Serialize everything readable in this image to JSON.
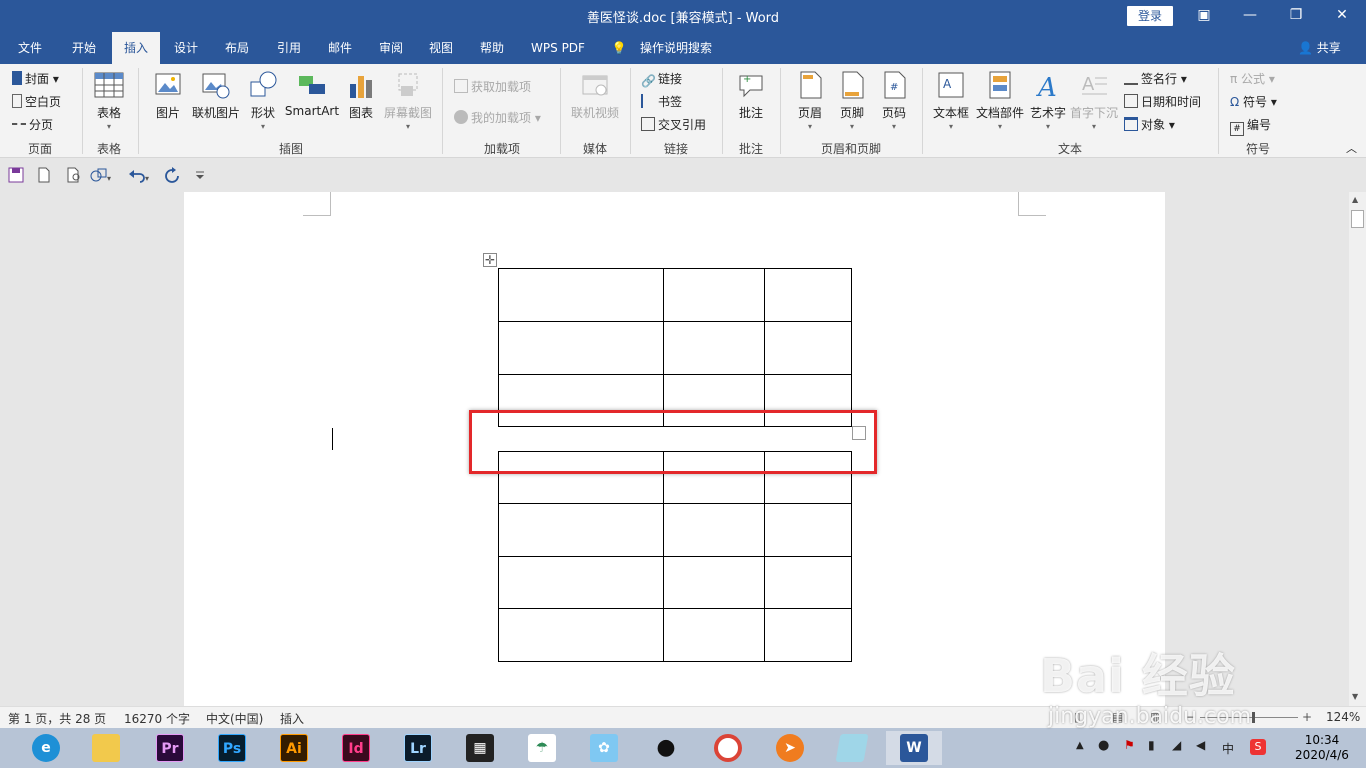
{
  "window": {
    "title": "善医怪谈.doc [兼容模式]  -  Word",
    "login_label": "登录"
  },
  "tabs": [
    {
      "label": "文件"
    },
    {
      "label": "开始"
    },
    {
      "label": "插入"
    },
    {
      "label": "设计"
    },
    {
      "label": "布局"
    },
    {
      "label": "引用"
    },
    {
      "label": "邮件"
    },
    {
      "label": "审阅"
    },
    {
      "label": "视图"
    },
    {
      "label": "帮助"
    },
    {
      "label": "WPS PDF"
    },
    {
      "label": "操作说明搜索"
    }
  ],
  "active_tab": "插入",
  "share_label": "共享",
  "ribbon": {
    "pages": {
      "group": "页面",
      "cover": "封面",
      "blank": "空白页",
      "break": "分页"
    },
    "tables": {
      "group": "表格",
      "table": "表格"
    },
    "illustrations": {
      "group": "插图",
      "picture": "图片",
      "online_picture": "联机图片",
      "shapes": "形状",
      "smartart": "SmartArt",
      "chart": "图表",
      "screenshot": "屏幕截图"
    },
    "addins": {
      "group": "加载项",
      "get": "获取加载项",
      "my": "我的加载项"
    },
    "media": {
      "group": "媒体",
      "online_video": "联机视频"
    },
    "links": {
      "group": "链接",
      "link": "链接",
      "bookmark": "书签",
      "cross_ref": "交叉引用"
    },
    "comments": {
      "group": "批注",
      "comment": "批注"
    },
    "header_footer": {
      "group": "页眉和页脚",
      "header": "页眉",
      "footer": "页脚",
      "page_number": "页码"
    },
    "text": {
      "group": "文本",
      "textbox": "文本框",
      "quick_parts": "文档部件",
      "wordart": "艺术字",
      "dropcap": "首字下沉",
      "signature": "签名行",
      "datetime": "日期和时间",
      "object": "对象"
    },
    "symbols": {
      "group": "符号",
      "equation": "公式",
      "symbol": "符号",
      "number": "编号"
    }
  },
  "status": {
    "page": "第 1 页，共 28 页",
    "words": "16270 个字",
    "language": "中文(中国)",
    "mode": "插入",
    "zoom": "124%"
  },
  "taskbar": {
    "apps": [
      "Pr",
      "Ps",
      "Ai",
      "Id",
      "Lr"
    ],
    "time": "10:34",
    "date": "2020/4/6",
    "ime": "中"
  },
  "watermark": {
    "brand": "Bai 经验",
    "url": "jingyan.baidu.com"
  },
  "colors": {
    "accent": "#2b579a",
    "highlight": "#e3282a"
  }
}
